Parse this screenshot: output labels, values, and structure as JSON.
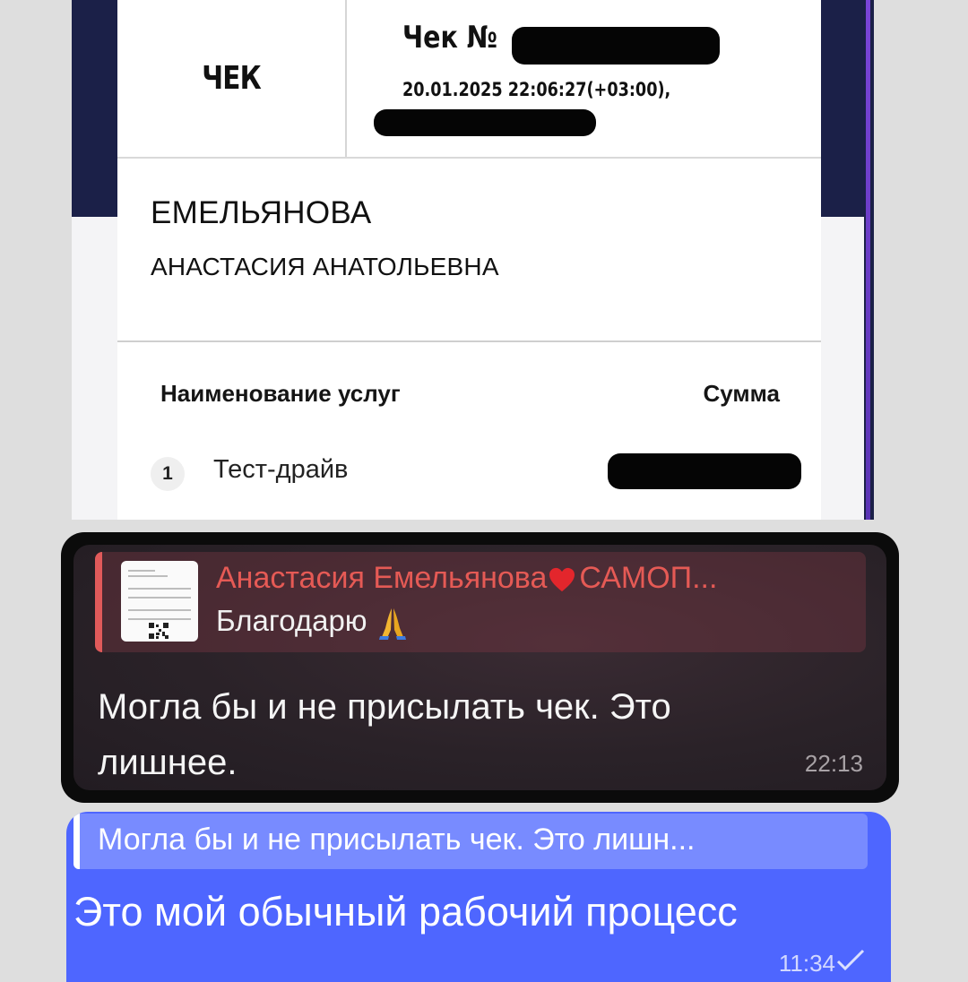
{
  "receipt": {
    "header_label": "ЧЕК",
    "check_number_label": "Чек №",
    "datetime": "20.01.2025 22:06:27(+03:00),",
    "last_name": "ЕМЕЛЬЯНОВА",
    "first_names": "АНАСТАСИЯ АНАТОЛЬЕВНА",
    "col_services": "Наименование услуг",
    "col_sum": "Сумма",
    "item_index": "1",
    "item_name": "Тест-драйв"
  },
  "incoming_message": {
    "reply_sender": "Анастасия Емельянова",
    "reply_sender_suffix": "САМОП...",
    "reply_text": "Благодарю",
    "text": "Могла бы и не присылать чек. Это лишнее.",
    "time": "22:13",
    "colors": {
      "sender": "#e55a55",
      "bubble": "#2a2228"
    }
  },
  "outgoing_message": {
    "quote_text": "Могла бы и не присылать чек. Это лишн...",
    "text": "Это мой обычный рабочий процесс",
    "time": "11:34",
    "colors": {
      "bubble": "#4e66ff"
    }
  }
}
